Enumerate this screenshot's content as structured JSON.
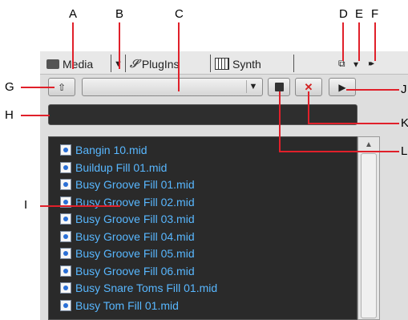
{
  "callouts": [
    "A",
    "B",
    "C",
    "D",
    "E",
    "F",
    "G",
    "H",
    "I",
    "J",
    "K",
    "L"
  ],
  "tabs": {
    "media_label": "Media",
    "plugins_label": "PlugIns",
    "synth_label": "Synth",
    "dropdown_glyph": "▼"
  },
  "toolbar": {
    "up_glyph": "⇧",
    "combo_arrow": "▼",
    "save_glyph": "💾",
    "delete_glyph": "✕",
    "play_glyph": "▶",
    "layout_glyph": "⧉",
    "menu_glyph": "▾",
    "expand_glyph": "▸▸"
  },
  "files": [
    "Bangin 10.mid",
    "Buildup Fill 01.mid",
    "Busy Groove Fill 01.mid",
    "Busy Groove Fill 02.mid",
    "Busy Groove Fill 03.mid",
    "Busy Groove Fill 04.mid",
    "Busy Groove Fill 05.mid",
    "Busy Groove Fill 06.mid",
    "Busy Snare Toms Fill 01.mid",
    "Busy Tom Fill 01.mid"
  ],
  "colors": {
    "callout_line": "#e0202a",
    "file_text": "#58b7ff",
    "delete": "#d22020"
  }
}
